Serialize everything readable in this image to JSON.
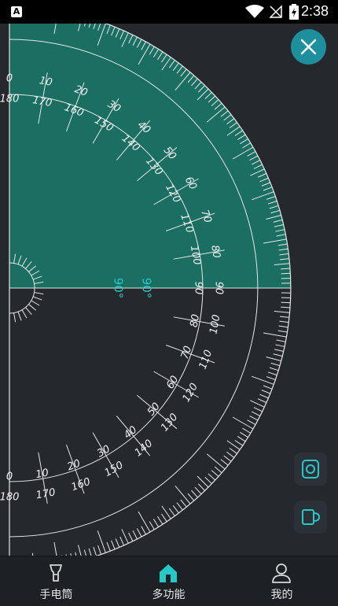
{
  "status_bar": {
    "time": "2:38",
    "app_badge": "A"
  },
  "protractor": {
    "outer_labels": [
      "0",
      "10",
      "20",
      "30",
      "40",
      "50",
      "60",
      "70",
      "80",
      "90",
      "100",
      "110",
      "120",
      "130",
      "140",
      "150",
      "160",
      "170",
      "180"
    ],
    "inner_labels": [
      "180",
      "170",
      "160",
      "150",
      "140",
      "130",
      "120",
      "110",
      "100",
      "90",
      "80",
      "70",
      "60",
      "50",
      "40",
      "30",
      "20",
      "10",
      "0"
    ],
    "readout_left": "90°",
    "readout_right": "90°"
  },
  "colors": {
    "accent": "#1e8f9c",
    "sector_fill": "#1b6e62",
    "teal_text": "#27c8c8"
  },
  "icons": {
    "close": "close-icon",
    "camera": "camera-icon",
    "flashlight": "flashlight-icon",
    "home": "home-icon",
    "profile": "profile-icon",
    "mug": "mug-icon"
  },
  "nav": {
    "items": [
      {
        "label": "手电筒"
      },
      {
        "label": "多功能"
      },
      {
        "label": "我的"
      }
    ]
  }
}
